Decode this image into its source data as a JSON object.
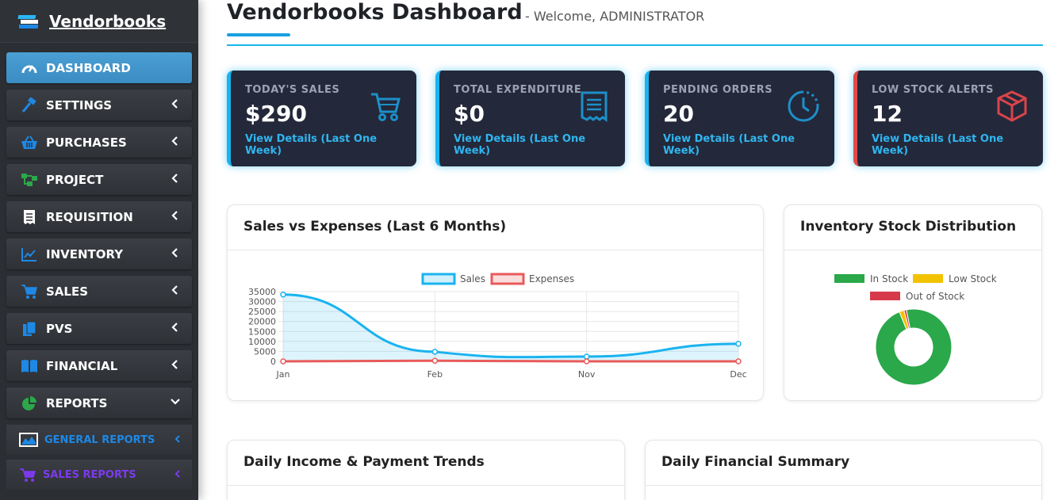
{
  "brand": {
    "title": "Vendorbooks"
  },
  "sidebar": {
    "items": [
      {
        "label": "DASHBOARD",
        "icon": "speedometer-icon",
        "active": true
      },
      {
        "label": "SETTINGS",
        "icon": "hammer-icon"
      },
      {
        "label": "PURCHASES",
        "icon": "basket-icon"
      },
      {
        "label": "PROJECT",
        "icon": "project-tree-icon"
      },
      {
        "label": "REQUISITION",
        "icon": "receipt-icon"
      },
      {
        "label": "INVENTORY",
        "icon": "line-chart-icon"
      },
      {
        "label": "SALES",
        "icon": "cart-icon"
      },
      {
        "label": "PVS",
        "icon": "copy-icon"
      },
      {
        "label": "FINANCIAL",
        "icon": "book-icon"
      },
      {
        "label": "REPORTS",
        "icon": "pie-chart-icon",
        "expanded": true
      }
    ],
    "subitems": [
      {
        "label": "GENERAL REPORTS",
        "icon": "area-chart-icon",
        "color": "#1e88e5"
      },
      {
        "label": "SALES REPORTS",
        "icon": "cart-icon",
        "color": "#7c3aed"
      }
    ]
  },
  "header": {
    "title": "Vendorbooks Dashboard",
    "welcome": "- Welcome, ADMINISTRATOR"
  },
  "stats": [
    {
      "label": "TODAY'S SALES",
      "value": "$290",
      "link": "View Details (Last One Week)",
      "icon": "cart-icon",
      "accent": "#1ab3ef"
    },
    {
      "label": "TOTAL EXPENDITURE",
      "value": "$0",
      "link": "View Details (Last One Week)",
      "icon": "receipt-icon",
      "accent": "#1ab3ef"
    },
    {
      "label": "PENDING ORDERS",
      "value": "20",
      "link": "View Details (Last One Week)",
      "icon": "clock-icon",
      "accent": "#1ab3ef"
    },
    {
      "label": "LOW STOCK ALERTS",
      "value": "12",
      "link": "View Details (Last One Week)",
      "icon": "box-icon",
      "accent": "#e04a4a"
    }
  ],
  "panels": {
    "sales_expenses": "Sales vs Expenses (Last 6 Months)",
    "inventory": "Inventory Stock Distribution",
    "daily_income": "Daily Income & Payment Trends",
    "daily_summary": "Daily Financial Summary"
  },
  "chart_data": [
    {
      "type": "line",
      "title": "Sales vs Expenses (Last 6 Months)",
      "x": [
        "Jan",
        "Feb",
        "Nov",
        "Dec"
      ],
      "series": [
        {
          "name": "Sales",
          "values": [
            33500,
            4800,
            2400,
            8800
          ],
          "color": "#1ab3ef"
        },
        {
          "name": "Expenses",
          "values": [
            0,
            300,
            0,
            0
          ],
          "color": "#e85a5a"
        }
      ],
      "ylim": [
        0,
        35000
      ],
      "yticks": [
        0,
        5000,
        10000,
        15000,
        20000,
        25000,
        30000,
        35000
      ],
      "legend": "top"
    },
    {
      "type": "pie",
      "title": "Inventory Stock Distribution",
      "labels": [
        "In Stock",
        "Low Stock",
        "Out of Stock"
      ],
      "values": [
        95,
        2,
        1
      ],
      "colors": [
        "#2aa84a",
        "#f2c200",
        "#d63a49"
      ],
      "legend": "top"
    }
  ]
}
